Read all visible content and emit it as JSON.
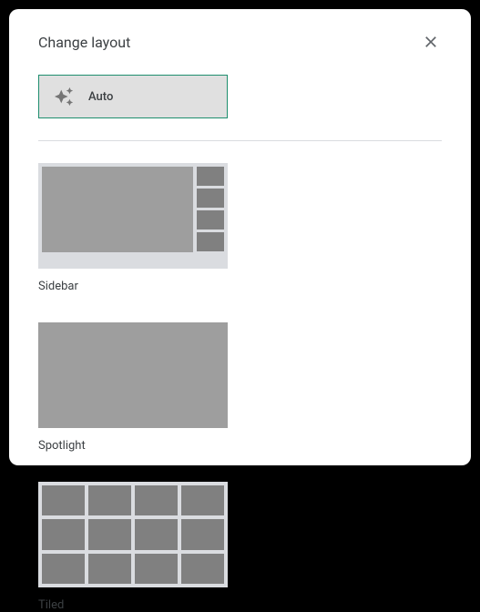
{
  "dialog": {
    "title": "Change layout"
  },
  "auto": {
    "label": "Auto"
  },
  "layouts": {
    "sidebar": {
      "label": "Sidebar"
    },
    "spotlight": {
      "label": "Spotlight"
    },
    "tiled": {
      "label": "Tiled"
    }
  }
}
